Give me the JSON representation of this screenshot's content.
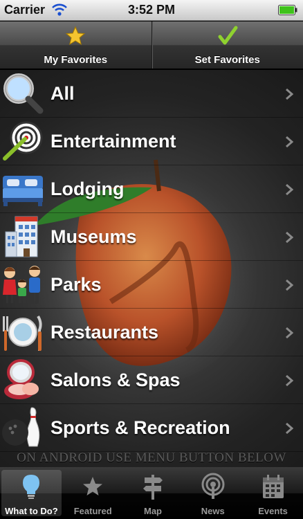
{
  "status_bar": {
    "carrier": "Carrier",
    "time": "3:52 PM"
  },
  "favorites_bar": {
    "my_favorites": "My Favorites",
    "set_favorites": "Set Favorites"
  },
  "categories": [
    {
      "label": "All",
      "icon": "magnifier-icon"
    },
    {
      "label": "Entertainment",
      "icon": "target-icon"
    },
    {
      "label": "Lodging",
      "icon": "bed-icon"
    },
    {
      "label": "Museums",
      "icon": "museum-building-icon"
    },
    {
      "label": "Parks",
      "icon": "family-icon"
    },
    {
      "label": "Restaurants",
      "icon": "plate-cutlery-icon"
    },
    {
      "label": "Salons & Spas",
      "icon": "compact-mirror-icon"
    },
    {
      "label": "Sports & Recreation",
      "icon": "bowling-icon"
    }
  ],
  "android_note": "ON ANDROID USE MENU BUTTON BELOW",
  "tabs": [
    {
      "label": "What to Do?",
      "icon": "lightbulb-icon",
      "active": true
    },
    {
      "label": "Featured",
      "icon": "star-icon"
    },
    {
      "label": "Map",
      "icon": "signpost-icon"
    },
    {
      "label": "News",
      "icon": "podcast-icon"
    },
    {
      "label": "Events",
      "icon": "calendar-icon"
    }
  ],
  "colors": {
    "accent_green": "#5cb800",
    "star_yellow": "#f4c430",
    "peach": "#c4572a"
  }
}
